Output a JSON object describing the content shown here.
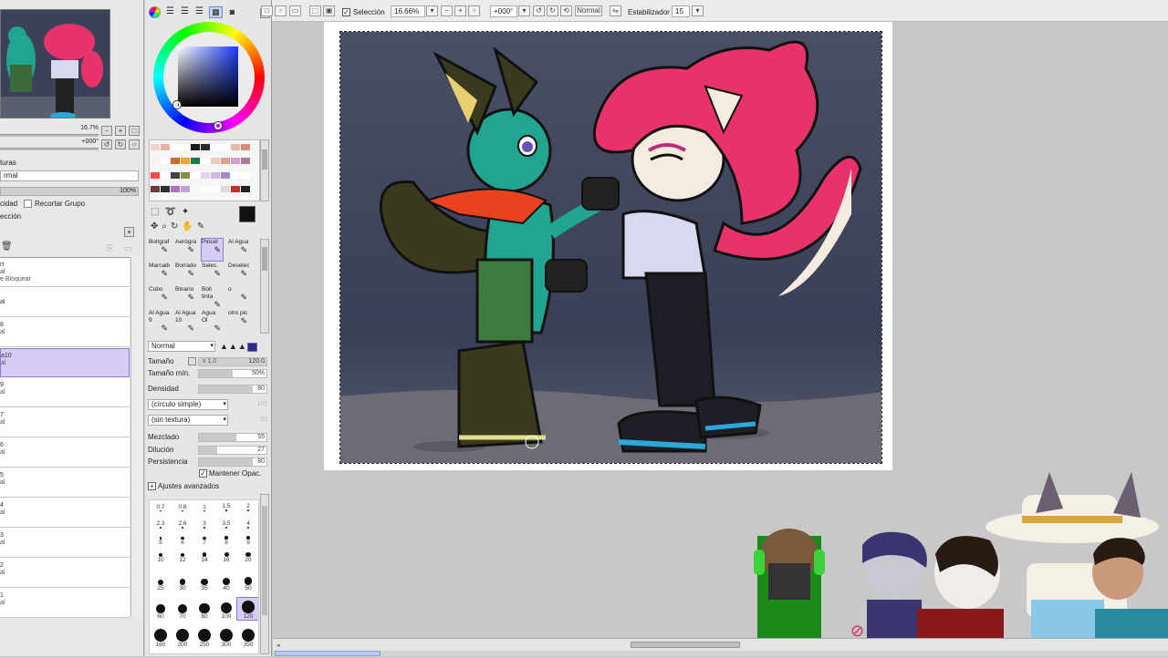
{
  "navigator": {
    "zoom": "16.7%",
    "angle": "+000°"
  },
  "layer_panel": {
    "section_label": "turas",
    "blend_mode": "rmal",
    "opacity": "100%",
    "opacity_label": "cidad",
    "clip_group_label": "Recortar Grupo",
    "selection_label": "ección",
    "layers": [
      {
        "name": "rt",
        "mode": "al",
        "extra": "e Bloquear",
        "selected": false
      },
      {
        "name": "al",
        "mode": "",
        "extra": "",
        "selected": false
      },
      {
        "name": "8",
        "mode": "al",
        "extra": "",
        "selected": false
      },
      {
        "name": "a10",
        "mode": "al",
        "extra": "",
        "selected": true
      },
      {
        "name": "9",
        "mode": "al",
        "extra": "",
        "selected": false
      },
      {
        "name": "7",
        "mode": "al",
        "extra": "",
        "selected": false
      },
      {
        "name": "6",
        "mode": "al",
        "extra": "",
        "selected": false
      },
      {
        "name": "5",
        "mode": "al",
        "extra": "",
        "selected": false
      },
      {
        "name": "4",
        "mode": "al",
        "extra": "",
        "selected": false
      },
      {
        "name": "3",
        "mode": "al",
        "extra": "",
        "selected": false
      },
      {
        "name": "2",
        "mode": "al",
        "extra": "",
        "selected": false
      },
      {
        "name": "1",
        "mode": "al",
        "extra": "",
        "selected": false
      }
    ]
  },
  "palette": {
    "swatches": [
      "#f2d6c8",
      "#e8b3a3",
      "#ffffff",
      "#ffffff",
      "#1a1a1a",
      "#2b2b2b",
      "#ffffff",
      "#ffffff",
      "#e6b9a6",
      "#d98a7a",
      "#f2f2f2",
      "#ffffff",
      "#cc6b2a",
      "#f2a23a",
      "#1f7a4a",
      "#ffffff",
      "#f0c9b8",
      "#e0a090",
      "#d4a0c8",
      "#b07a9a",
      "#ff4b4b",
      "#ffffff",
      "#444444",
      "#8c8c3a",
      "#ffffff",
      "#e7d0f0",
      "#d0b8e8",
      "#a090d0",
      "#ffffff",
      "#ffffff",
      "#6a3a3a",
      "#2d2d2d",
      "#b070c0",
      "#c8a0d8",
      "#fafafa",
      "#ffffff",
      "#ffffff",
      "#dcdcdc",
      "#c83030",
      "#222222"
    ],
    "primary_color": "#111111",
    "secondary_color": "#ffffff"
  },
  "tools": [
    {
      "label": "Bolígraf.",
      "icon": "pen-icon",
      "selected": false
    },
    {
      "label": "Aerógraf",
      "icon": "airbrush-icon",
      "selected": false
    },
    {
      "label": "Pincel",
      "icon": "brush-icon",
      "selected": true
    },
    {
      "label": "Al Agua",
      "icon": "watercolor-icon",
      "selected": false
    },
    {
      "label": "Marcador",
      "icon": "marker-icon",
      "selected": false
    },
    {
      "label": "Borrador",
      "icon": "eraser-icon",
      "selected": false
    },
    {
      "label": "Selec.",
      "icon": "select-pen-icon",
      "selected": false
    },
    {
      "label": "Deselec.",
      "icon": "deselect-pen-icon",
      "selected": false
    },
    {
      "label": "Cubo",
      "icon": "bucket-icon",
      "selected": false
    },
    {
      "label": "Binario",
      "icon": "binary-pen-icon",
      "selected": false
    },
    {
      "label": "Boli tinta",
      "icon": "ink-pen-icon",
      "selected": false
    },
    {
      "label": "o",
      "icon": "pen-icon",
      "selected": false
    },
    {
      "label": "Al Agua 9",
      "icon": "watercolor-icon",
      "selected": false
    },
    {
      "label": "Al Agua 10",
      "icon": "watercolor-icon",
      "selected": false
    },
    {
      "label": "Agua Ol",
      "icon": "watercolor-icon",
      "selected": false
    },
    {
      "label": "otro pic",
      "icon": "brush-icon",
      "selected": false
    }
  ],
  "brush": {
    "blend_mode": "Normal",
    "size_label": "Tamaño",
    "size_multiplier": "x 1.0",
    "size_value": "120.0",
    "min_size_label": "Tamaño mín.",
    "min_size_value": "50%",
    "density_label": "Densidad",
    "density_value": "80",
    "shape": "(círculo simple)",
    "shape_value": "100",
    "texture": "(sin textura)",
    "texture_value": "95",
    "blend_label": "Mezclado",
    "blend_value": "55",
    "dilution_label": "Dilución",
    "dilution_value": "27",
    "persistence_label": "Persistencia",
    "persistence_value": "80",
    "keep_opacity_label": "Mantener Opac.",
    "keep_opacity_checked": true,
    "advanced_label": "Ajustes avanzados"
  },
  "brush_sizes": [
    "0.7",
    "0.8",
    "1",
    "1.5",
    "2",
    "2.3",
    "2.6",
    "3",
    "3.5",
    "4",
    "5",
    "6",
    "7",
    "8",
    "9",
    "10",
    "12",
    "14",
    "16",
    "20",
    "25",
    "30",
    "35",
    "40",
    "50",
    "60",
    "70",
    "80",
    "100",
    "120",
    "160",
    "200",
    "250",
    "300",
    "350"
  ],
  "selected_brush_size": "120",
  "toolbar": {
    "selection_label": "Selección",
    "selection_checked": true,
    "zoom_value": "16.66%",
    "angle_value": "+000°",
    "blend_mode": "Normal",
    "stabilizer_label": "Estabilizador",
    "stabilizer_value": "15"
  }
}
